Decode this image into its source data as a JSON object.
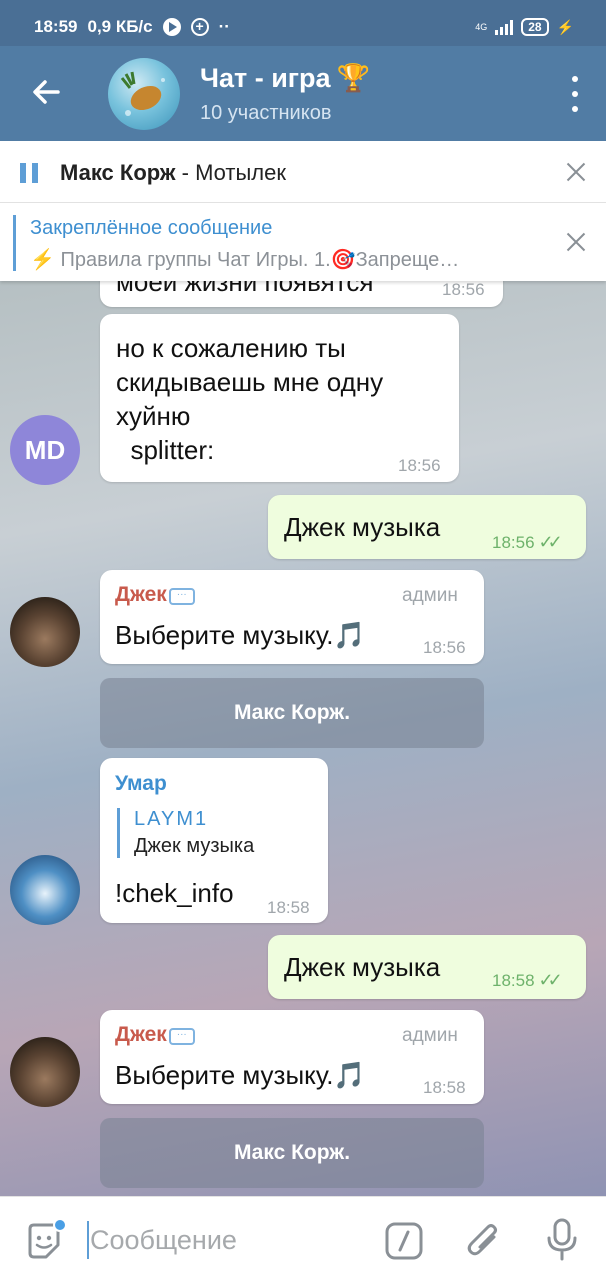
{
  "status_bar": {
    "time": "18:59",
    "net_speed": "0,9 КБ/с",
    "network": "4G",
    "battery": "28"
  },
  "header": {
    "title": "Чат - игра",
    "trophy": "🏆",
    "subtitle": "10 участников"
  },
  "player": {
    "artist": "Макс Корж",
    "separator": " - ",
    "track": "Мотылек"
  },
  "pinned": {
    "title": "Закреплённое сообщение",
    "text": "⚡ Правила группы Чат Игры. 1.🎯Запреще…"
  },
  "messages": {
    "m0": {
      "text": "моей жизни появятся",
      "time": "18:56"
    },
    "m1": {
      "text_line1": "но к сожалению ты",
      "text_line2": "скидываешь мне одну",
      "text_line3": "хуйню",
      "text_line4": "  splitter:",
      "time": "18:56",
      "avatar_initials": "MD"
    },
    "m2": {
      "text": "Джек музыка",
      "time": "18:56"
    },
    "m3": {
      "sender": "Джек",
      "role": "админ",
      "text": "Выберите музыку.🎵",
      "time": "18:56"
    },
    "b1": {
      "label": "Макс Корж."
    },
    "m4": {
      "sender": "Умар",
      "reply_name": "LAYM1",
      "reply_text": "Джек музыка",
      "text": "!chek_info",
      "time": "18:58"
    },
    "m5": {
      "text": "Джек музыка",
      "time": "18:58"
    },
    "m6": {
      "sender": "Джек",
      "role": "админ",
      "text": "Выберите музыку.🎵",
      "time": "18:58"
    },
    "b2": {
      "label": "Макс Корж."
    }
  },
  "composer": {
    "placeholder": "Сообщение"
  },
  "colors": {
    "status_bar": "#4a6f95",
    "app_bar": "#517ca4",
    "accent": "#3e8fd0",
    "outgoing_bubble": "#effdde",
    "sender_jack": "#c85a4c"
  },
  "icons": [
    "back-arrow-icon",
    "more-vert-icon",
    "pause-icon",
    "close-icon",
    "sticker-icon",
    "bot-command-icon",
    "attach-icon",
    "mic-icon",
    "double-check-icon"
  ]
}
